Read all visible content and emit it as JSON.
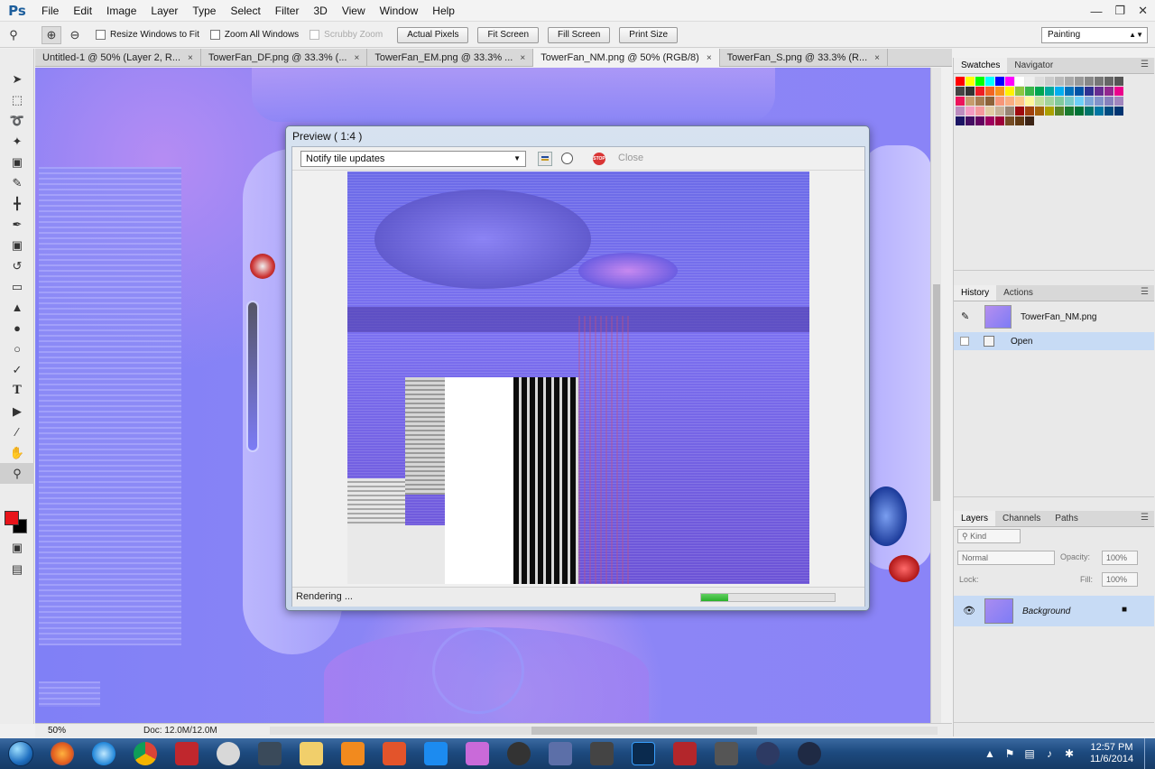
{
  "app": {
    "logo": "Ps"
  },
  "menu": [
    "File",
    "Edit",
    "Image",
    "Layer",
    "Type",
    "Select",
    "Filter",
    "3D",
    "View",
    "Window",
    "Help"
  ],
  "window_controls": [
    "minimize",
    "restore",
    "close"
  ],
  "options_bar": {
    "resize_windows": "Resize Windows to Fit",
    "zoom_all": "Zoom All Windows",
    "scrubby": "Scrubby Zoom",
    "actual_pixels": "Actual Pixels",
    "fit_screen": "Fit Screen",
    "fill_screen": "Fill Screen",
    "print_size": "Print Size",
    "workspace": "Painting"
  },
  "tabs": [
    "Untitled-1 @ 50% (Layer 2, R...",
    "TowerFan_DF.png @ 33.3% (...",
    "TowerFan_EM.png @ 33.3% ...",
    "TowerFan_NM.png @ 50% (RGB/8)",
    "TowerFan_S.png @ 33.3% (R..."
  ],
  "status": {
    "zoom": "50%",
    "doc": "Doc: 12.0M/12.0M"
  },
  "dialog": {
    "title": "Preview ( 1:4 )",
    "select_value": "Notify tile updates",
    "close": "Close",
    "rendering": "Rendering ...",
    "progress_fraction": 0.2
  },
  "panels": {
    "swatches_tab": "Swatches",
    "navigator_tab": "Navigator",
    "history_tab": "History",
    "actions_tab": "Actions",
    "history_items": [
      {
        "label": "TowerFan_NM.png"
      },
      {
        "label": "Open"
      }
    ],
    "layers_tab": "Layers",
    "channels_tab": "Channels",
    "paths_tab": "Paths",
    "kind": "Kind",
    "blend_mode": "Normal",
    "opacity_label": "Opacity:",
    "opacity_value": "100%",
    "lock_label": "Lock:",
    "fill_label": "Fill:",
    "fill_value": "100%",
    "layer_name": "Background"
  },
  "colors": {
    "foreground": "#e8141a",
    "background": "#000000",
    "canvas_normal": "#8080f6",
    "progress": "#2ab12a"
  },
  "swatch_colors": [
    "#ff0000",
    "#ffff00",
    "#00ff00",
    "#00ffff",
    "#0000ff",
    "#ff00ff",
    "#ffffff",
    "#eeeeee",
    "#dddddd",
    "#cccccc",
    "#bbbbbb",
    "#aaaaaa",
    "#999999",
    "#888888",
    "#777777",
    "#666666",
    "#555555",
    "#444444",
    "#333333",
    "#ee1d24",
    "#f26522",
    "#f7941d",
    "#fff200",
    "#8dc63f",
    "#39b54a",
    "#00a651",
    "#00a99d",
    "#00aeef",
    "#0072bc",
    "#0054a6",
    "#2e3192",
    "#662d91",
    "#92278f",
    "#ec008c",
    "#ed145b",
    "#c69c6d",
    "#a67c52",
    "#8c6239",
    "#f69679",
    "#f9ad81",
    "#fdc68a",
    "#fff79a",
    "#c4df9b",
    "#a3d39c",
    "#82ca9d",
    "#7accc8",
    "#6dcff6",
    "#7da7d9",
    "#8393ca",
    "#8781bd",
    "#a186be",
    "#bd8cbf",
    "#f49ac1",
    "#f5989d",
    "#e2cba4",
    "#c7b299",
    "#998675",
    "#9e0b0f",
    "#a0410d",
    "#a36209",
    "#aba000",
    "#598527",
    "#1a7b30",
    "#007236",
    "#00746b",
    "#0076a3",
    "#004b80",
    "#003471",
    "#1b1464",
    "#440e62",
    "#630460",
    "#9e005d",
    "#9e0039",
    "#754c24",
    "#603913",
    "#3c2415"
  ],
  "taskbar": {
    "apps": [
      "firefox",
      "ie",
      "chrome",
      "filezilla",
      "app-5",
      "app-6",
      "explorer",
      "media",
      "app-9",
      "dropbox",
      "xnview",
      "app-12",
      "app-13",
      "zbrush",
      "photoshop",
      "app-16",
      "app-17",
      "app-18",
      "app-19"
    ],
    "time": "12:57 PM",
    "date": "11/6/2014"
  }
}
